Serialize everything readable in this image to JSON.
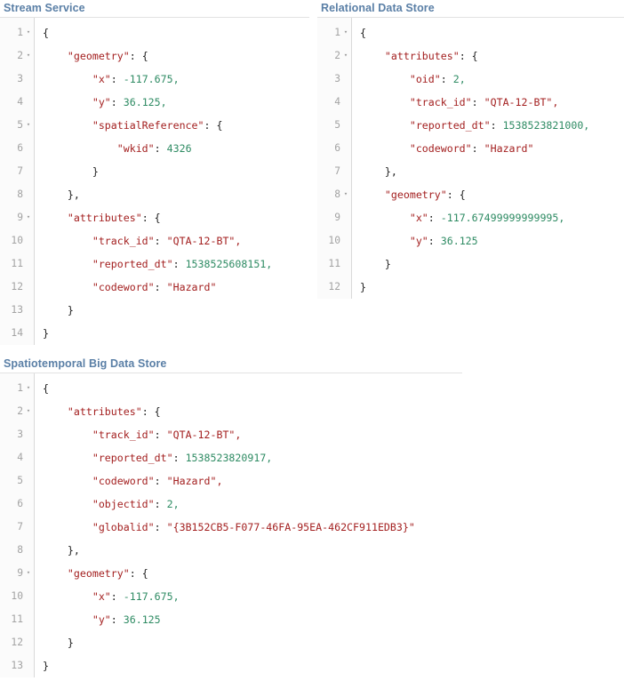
{
  "panels": [
    {
      "id": "stream-service",
      "title": "Stream Service",
      "lines": [
        {
          "n": "1",
          "fold": true,
          "indent": 0,
          "tokens": [
            {
              "t": "punct",
              "v": "{"
            }
          ]
        },
        {
          "n": "2",
          "fold": true,
          "indent": 1,
          "tokens": [
            {
              "t": "key",
              "v": "\"geometry\""
            },
            {
              "t": "colon",
              "v": ": "
            },
            {
              "t": "punct",
              "v": "{"
            }
          ]
        },
        {
          "n": "3",
          "fold": false,
          "indent": 2,
          "tokens": [
            {
              "t": "key",
              "v": "\"x\""
            },
            {
              "t": "colon",
              "v": ": "
            },
            {
              "t": "num",
              "v": "-117.675,"
            }
          ]
        },
        {
          "n": "4",
          "fold": false,
          "indent": 2,
          "tokens": [
            {
              "t": "key",
              "v": "\"y\""
            },
            {
              "t": "colon",
              "v": ": "
            },
            {
              "t": "num",
              "v": "36.125,"
            }
          ]
        },
        {
          "n": "5",
          "fold": true,
          "indent": 2,
          "tokens": [
            {
              "t": "key",
              "v": "\"spatialReference\""
            },
            {
              "t": "colon",
              "v": ": "
            },
            {
              "t": "punct",
              "v": "{"
            }
          ]
        },
        {
          "n": "6",
          "fold": false,
          "indent": 3,
          "tokens": [
            {
              "t": "key",
              "v": "\"wkid\""
            },
            {
              "t": "colon",
              "v": ": "
            },
            {
              "t": "num",
              "v": "4326"
            }
          ]
        },
        {
          "n": "7",
          "fold": false,
          "indent": 2,
          "tokens": [
            {
              "t": "punct",
              "v": "}"
            }
          ]
        },
        {
          "n": "8",
          "fold": false,
          "indent": 1,
          "tokens": [
            {
              "t": "punct",
              "v": "},"
            }
          ]
        },
        {
          "n": "9",
          "fold": true,
          "indent": 1,
          "tokens": [
            {
              "t": "key",
              "v": "\"attributes\""
            },
            {
              "t": "colon",
              "v": ": "
            },
            {
              "t": "punct",
              "v": "{"
            }
          ]
        },
        {
          "n": "10",
          "fold": false,
          "indent": 2,
          "tokens": [
            {
              "t": "key",
              "v": "\"track_id\""
            },
            {
              "t": "colon",
              "v": ": "
            },
            {
              "t": "str",
              "v": "\"QTA-12-BT\","
            }
          ]
        },
        {
          "n": "11",
          "fold": false,
          "indent": 2,
          "tokens": [
            {
              "t": "key",
              "v": "\"reported_dt\""
            },
            {
              "t": "colon",
              "v": ": "
            },
            {
              "t": "num",
              "v": "1538525608151,"
            }
          ]
        },
        {
          "n": "12",
          "fold": false,
          "indent": 2,
          "tokens": [
            {
              "t": "key",
              "v": "\"codeword\""
            },
            {
              "t": "colon",
              "v": ": "
            },
            {
              "t": "str",
              "v": "\"Hazard\""
            }
          ]
        },
        {
          "n": "13",
          "fold": false,
          "indent": 1,
          "tokens": [
            {
              "t": "punct",
              "v": "}"
            }
          ]
        },
        {
          "n": "14",
          "fold": false,
          "indent": 0,
          "tokens": [
            {
              "t": "punct",
              "v": "}"
            }
          ]
        }
      ]
    },
    {
      "id": "relational-data-store",
      "title": "Relational Data Store",
      "lines": [
        {
          "n": "1",
          "fold": true,
          "indent": 0,
          "tokens": [
            {
              "t": "punct",
              "v": "{"
            }
          ]
        },
        {
          "n": "2",
          "fold": true,
          "indent": 1,
          "tokens": [
            {
              "t": "key",
              "v": "\"attributes\""
            },
            {
              "t": "colon",
              "v": ": "
            },
            {
              "t": "punct",
              "v": "{"
            }
          ]
        },
        {
          "n": "3",
          "fold": false,
          "indent": 2,
          "highlight": true,
          "tokens": [
            {
              "t": "key",
              "v": "\"oid\""
            },
            {
              "t": "colon",
              "v": ": "
            },
            {
              "t": "num",
              "v": "2,"
            }
          ]
        },
        {
          "n": "4",
          "fold": false,
          "indent": 2,
          "tokens": [
            {
              "t": "key",
              "v": "\"track_id\""
            },
            {
              "t": "colon",
              "v": ": "
            },
            {
              "t": "str",
              "v": "\"QTA-12-BT\","
            }
          ]
        },
        {
          "n": "5",
          "fold": false,
          "indent": 2,
          "tokens": [
            {
              "t": "key",
              "v": "\"reported_dt\""
            },
            {
              "t": "colon",
              "v": ": "
            },
            {
              "t": "num",
              "v": "1538523821000,"
            }
          ]
        },
        {
          "n": "6",
          "fold": false,
          "indent": 2,
          "tokens": [
            {
              "t": "key",
              "v": "\"codeword\""
            },
            {
              "t": "colon",
              "v": ": "
            },
            {
              "t": "str",
              "v": "\"Hazard\""
            }
          ]
        },
        {
          "n": "7",
          "fold": false,
          "indent": 1,
          "tokens": [
            {
              "t": "punct",
              "v": "},"
            }
          ]
        },
        {
          "n": "8",
          "fold": true,
          "indent": 1,
          "tokens": [
            {
              "t": "key",
              "v": "\"geometry\""
            },
            {
              "t": "colon",
              "v": ": "
            },
            {
              "t": "punct",
              "v": "{"
            }
          ]
        },
        {
          "n": "9",
          "fold": false,
          "indent": 2,
          "tokens": [
            {
              "t": "key",
              "v": "\"x\""
            },
            {
              "t": "colon",
              "v": ": "
            },
            {
              "t": "num",
              "v": "-117.67499999999995,"
            }
          ]
        },
        {
          "n": "10",
          "fold": false,
          "indent": 2,
          "tokens": [
            {
              "t": "key",
              "v": "\"y\""
            },
            {
              "t": "colon",
              "v": ": "
            },
            {
              "t": "num",
              "v": "36.125"
            }
          ]
        },
        {
          "n": "11",
          "fold": false,
          "indent": 1,
          "tokens": [
            {
              "t": "punct",
              "v": "}"
            }
          ]
        },
        {
          "n": "12",
          "fold": false,
          "indent": 0,
          "tokens": [
            {
              "t": "punct",
              "v": "}"
            }
          ]
        }
      ]
    },
    {
      "id": "spatiotemporal-big-data-store",
      "title": "Spatiotemporal Big Data Store",
      "lines": [
        {
          "n": "1",
          "fold": true,
          "indent": 0,
          "tokens": [
            {
              "t": "punct",
              "v": "{"
            }
          ]
        },
        {
          "n": "2",
          "fold": true,
          "indent": 1,
          "tokens": [
            {
              "t": "key",
              "v": "\"attributes\""
            },
            {
              "t": "colon",
              "v": ": "
            },
            {
              "t": "punct",
              "v": "{"
            }
          ]
        },
        {
          "n": "3",
          "fold": false,
          "indent": 2,
          "tokens": [
            {
              "t": "key",
              "v": "\"track_id\""
            },
            {
              "t": "colon",
              "v": ": "
            },
            {
              "t": "str",
              "v": "\"QTA-12-BT\","
            }
          ]
        },
        {
          "n": "4",
          "fold": false,
          "indent": 2,
          "tokens": [
            {
              "t": "key",
              "v": "\"reported_dt\""
            },
            {
              "t": "colon",
              "v": ": "
            },
            {
              "t": "num",
              "v": "1538523820917,"
            }
          ]
        },
        {
          "n": "5",
          "fold": false,
          "indent": 2,
          "tokens": [
            {
              "t": "key",
              "v": "\"codeword\""
            },
            {
              "t": "colon",
              "v": ": "
            },
            {
              "t": "str",
              "v": "\"Hazard\","
            }
          ]
        },
        {
          "n": "6",
          "fold": false,
          "indent": 2,
          "highlight": "top",
          "tokens": [
            {
              "t": "key",
              "v": "\"objectid\""
            },
            {
              "t": "colon",
              "v": ": "
            },
            {
              "t": "num",
              "v": "2,"
            }
          ]
        },
        {
          "n": "7",
          "fold": false,
          "indent": 2,
          "highlight": "bottom",
          "tokens": [
            {
              "t": "key",
              "v": "\"globalid\""
            },
            {
              "t": "colon",
              "v": ": "
            },
            {
              "t": "str",
              "v": "\"{3B152CB5-F077-46FA-95EA-462CF911EDB3}\""
            }
          ]
        },
        {
          "n": "8",
          "fold": false,
          "indent": 1,
          "tokens": [
            {
              "t": "punct",
              "v": "},"
            }
          ]
        },
        {
          "n": "9",
          "fold": true,
          "indent": 1,
          "tokens": [
            {
              "t": "key",
              "v": "\"geometry\""
            },
            {
              "t": "colon",
              "v": ": "
            },
            {
              "t": "punct",
              "v": "{"
            }
          ]
        },
        {
          "n": "10",
          "fold": false,
          "indent": 2,
          "tokens": [
            {
              "t": "key",
              "v": "\"x\""
            },
            {
              "t": "colon",
              "v": ": "
            },
            {
              "t": "num",
              "v": "-117.675,"
            }
          ]
        },
        {
          "n": "11",
          "fold": false,
          "indent": 2,
          "tokens": [
            {
              "t": "key",
              "v": "\"y\""
            },
            {
              "t": "colon",
              "v": ": "
            },
            {
              "t": "num",
              "v": "36.125"
            }
          ]
        },
        {
          "n": "12",
          "fold": false,
          "indent": 1,
          "tokens": [
            {
              "t": "punct",
              "v": "}"
            }
          ]
        },
        {
          "n": "13",
          "fold": false,
          "indent": 0,
          "tokens": [
            {
              "t": "punct",
              "v": "}"
            }
          ]
        }
      ]
    }
  ],
  "icons": {
    "fold_collapse": "▾"
  },
  "colors": {
    "panel_title": "#5a7fa6",
    "line_number": "#a3a3a3",
    "key": "#a31f1f",
    "string": "#a31f1f",
    "number": "#2e8b63",
    "punctuation": "#1f1f1f",
    "highlight": "#fde99b",
    "gutter_background": "#fbfbfb",
    "rule": "#e2e2e2"
  }
}
